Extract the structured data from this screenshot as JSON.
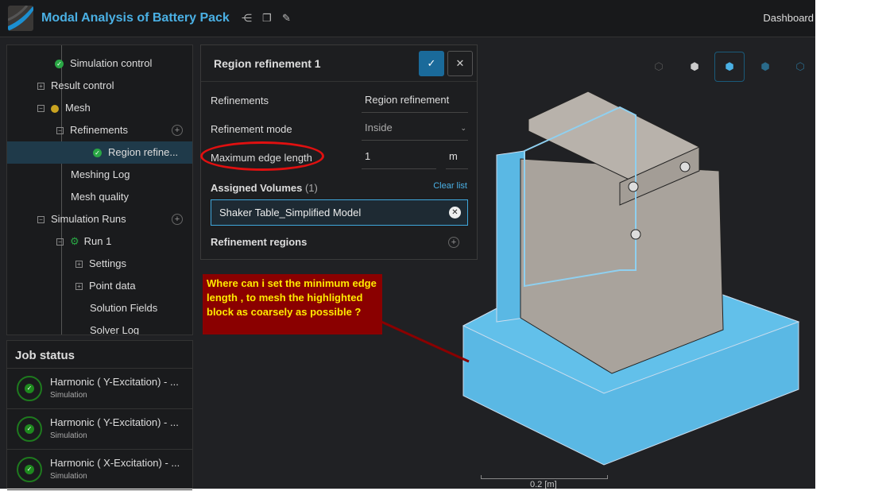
{
  "header": {
    "title": "Modal Analysis of Battery Pack",
    "nav": "Dashboard",
    "icons": [
      "share-icon",
      "copy-icon",
      "edit-icon"
    ]
  },
  "tree": {
    "items": [
      {
        "label": "Simulation control"
      },
      {
        "label": "Result control"
      },
      {
        "label": "Mesh"
      },
      {
        "label": "Refinements"
      },
      {
        "label": "Region refine..."
      },
      {
        "label": "Meshing Log"
      },
      {
        "label": "Mesh quality"
      },
      {
        "label": "Simulation Runs"
      },
      {
        "label": "Run 1"
      },
      {
        "label": "Settings"
      },
      {
        "label": "Point data"
      },
      {
        "label": "Solution Fields"
      },
      {
        "label": "Solver Log"
      }
    ]
  },
  "jobs": {
    "title": "Job status",
    "items": [
      {
        "title": "Harmonic ( Y-Excitation) - ...",
        "type": "Simulation"
      },
      {
        "title": "Harmonic ( Y-Excitation) - ...",
        "type": "Simulation"
      },
      {
        "title": "Harmonic ( X-Excitation) - ...",
        "type": "Simulation"
      }
    ]
  },
  "dialog": {
    "title": "Region refinement 1",
    "confirm": "✓",
    "close": "✕",
    "refinements_label": "Refinements",
    "refinements_value": "Region refinement",
    "mode_label": "Refinement mode",
    "mode_value": "Inside",
    "max_edge_label": "Maximum edge length",
    "max_edge_value": "1",
    "max_edge_unit": "m",
    "assigned_label": "Assigned Volumes",
    "assigned_count": "(1)",
    "clear": "Clear list",
    "volume": "Shaker Table_Simplified Model",
    "regions_label": "Refinement regions"
  },
  "annotation": "Where can i set the minimum edge length , to mesh the highlighted block as coarsely as possible ?",
  "scale": "0.2 [m]",
  "colors": {
    "accent": "#4ab0e4",
    "highlight": "#5ab8e4",
    "annotation_bg": "#8a0000",
    "annotation_text": "#ffea00"
  }
}
